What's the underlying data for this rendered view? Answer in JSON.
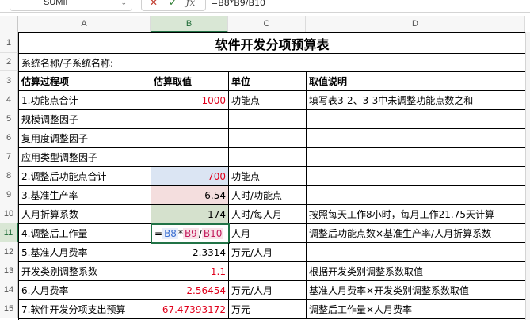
{
  "formula_bar": {
    "name_box": "SUMIF",
    "cancel_icon": "✕",
    "enter_icon": "✓",
    "fx_icon": "ƒx",
    "formula": "=B8*B9/B10"
  },
  "columns": [
    "A",
    "B",
    "C",
    "D"
  ],
  "rows": [
    "1",
    "2",
    "3",
    "4",
    "5",
    "6",
    "7",
    "8",
    "9",
    "10",
    "11",
    "12",
    "13",
    "14",
    "15"
  ],
  "sheet": {
    "title": "软件开发分项预算表",
    "system_name_label": "系统名称/子系统名称:",
    "headers": [
      "估算过程项",
      "估算取值",
      "单位",
      "取值说明"
    ],
    "items": [
      {
        "item": "1.功能点合计",
        "value": "1000",
        "unit": "功能点",
        "note": "填写表3-2、3-3中未调整功能点数之和"
      },
      {
        "item": "规模调整因子",
        "value": "",
        "unit": "——",
        "note": ""
      },
      {
        "item": "复用度调整因子",
        "value": "",
        "unit": "——",
        "note": ""
      },
      {
        "item": "应用类型调整因子",
        "value": "",
        "unit": "——",
        "note": ""
      },
      {
        "item": "2.调整后功能点合计",
        "value": "700",
        "unit": "功能点",
        "note": ""
      },
      {
        "item": "3.基准生产率",
        "value": "6.54",
        "unit": "人时/功能点",
        "note": ""
      },
      {
        "item": "人月折算系数",
        "value": "174",
        "unit": "人时/每人月",
        "note": "按照每天工作8小时，每月工作21.75天计算"
      },
      {
        "item": "4.调整后工作量",
        "value": "=B8*B9/B10",
        "unit": "人月",
        "note": "调整后功能点数×基准生产率/人月折算系数"
      },
      {
        "item": "5.基准人月费率",
        "value": "2.3314",
        "unit": "万元/人月",
        "note": ""
      },
      {
        "item": "开发类别调整系数",
        "value": "1.1",
        "unit": "——",
        "note": "根据开发类别调整系数取值"
      },
      {
        "item": "6.人月费率",
        "value": "2.56454",
        "unit": "万元/人月",
        "note": "基准人月费率×开发类别调整系数取值"
      },
      {
        "item": "7.软件开发分项支出预算",
        "value": "67.47393172",
        "unit": "万元",
        "note": "调整后工作量×人月费率"
      }
    ],
    "formula_refs": {
      "eq": "=",
      "r1": "B8",
      "op1": "*",
      "r2": "B9",
      "op2": "/",
      "r3": "B10"
    }
  }
}
